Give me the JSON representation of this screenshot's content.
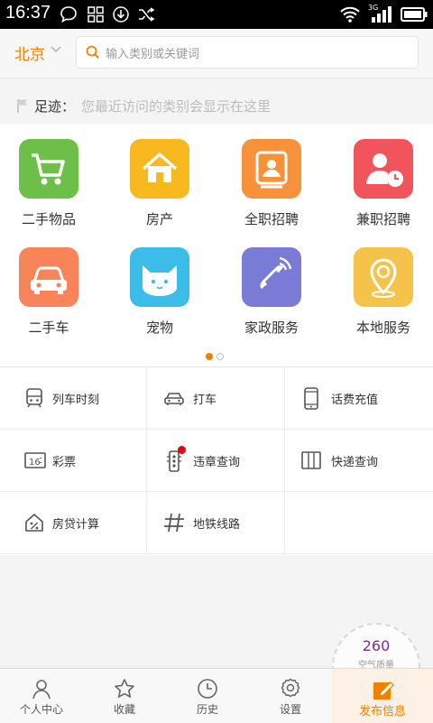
{
  "status_bar": {
    "time": "16:37",
    "network_label": "3G"
  },
  "header": {
    "city": "北京",
    "search_placeholder": "输入类别或关键词"
  },
  "footprint": {
    "label": "足迹：",
    "hint": "您最近访问的类别会显示在这里"
  },
  "categories": [
    {
      "label": "二手物品",
      "icon": "shopping-cart-icon",
      "color": "#6cc04a"
    },
    {
      "label": "房产",
      "icon": "house-icon",
      "color": "#f8b81f"
    },
    {
      "label": "全职招聘",
      "icon": "id-card-icon",
      "color": "#f7923a"
    },
    {
      "label": "兼职招聘",
      "icon": "person-clock-icon",
      "color": "#f2545b"
    },
    {
      "label": "二手车",
      "icon": "car-icon",
      "color": "#f8845a"
    },
    {
      "label": "宠物",
      "icon": "cat-icon",
      "color": "#3cbce9"
    },
    {
      "label": "家政服务",
      "icon": "phone-handset-icon",
      "color": "#7a7bd6"
    },
    {
      "label": "本地服务",
      "icon": "location-pin-icon",
      "color": "#f5c34a"
    }
  ],
  "pager": {
    "total": 2,
    "active": 1
  },
  "tools": [
    {
      "label": "列车时刻",
      "icon": "train-icon"
    },
    {
      "label": "打车",
      "icon": "taxi-icon"
    },
    {
      "label": "话费充值",
      "icon": "mobile-phone-icon"
    },
    {
      "label": "彩票",
      "icon": "lottery-icon"
    },
    {
      "label": "违章查询",
      "icon": "traffic-light-icon"
    },
    {
      "label": "快递查询",
      "icon": "package-icon"
    },
    {
      "label": "房贷计算",
      "icon": "house-percent-icon"
    },
    {
      "label": "地铁线路",
      "icon": "subway-hash-icon"
    }
  ],
  "air_quality": {
    "value": "260",
    "label": "空气质量"
  },
  "tabbar": [
    {
      "label": "个人中心",
      "icon": "person-icon"
    },
    {
      "label": "收藏",
      "icon": "star-icon"
    },
    {
      "label": "历史",
      "icon": "clock-icon"
    },
    {
      "label": "设置",
      "icon": "gear-icon"
    },
    {
      "label": "发布信息",
      "icon": "edit-icon"
    }
  ],
  "colors": {
    "accent": "#f08200",
    "badge": "#e60012"
  }
}
